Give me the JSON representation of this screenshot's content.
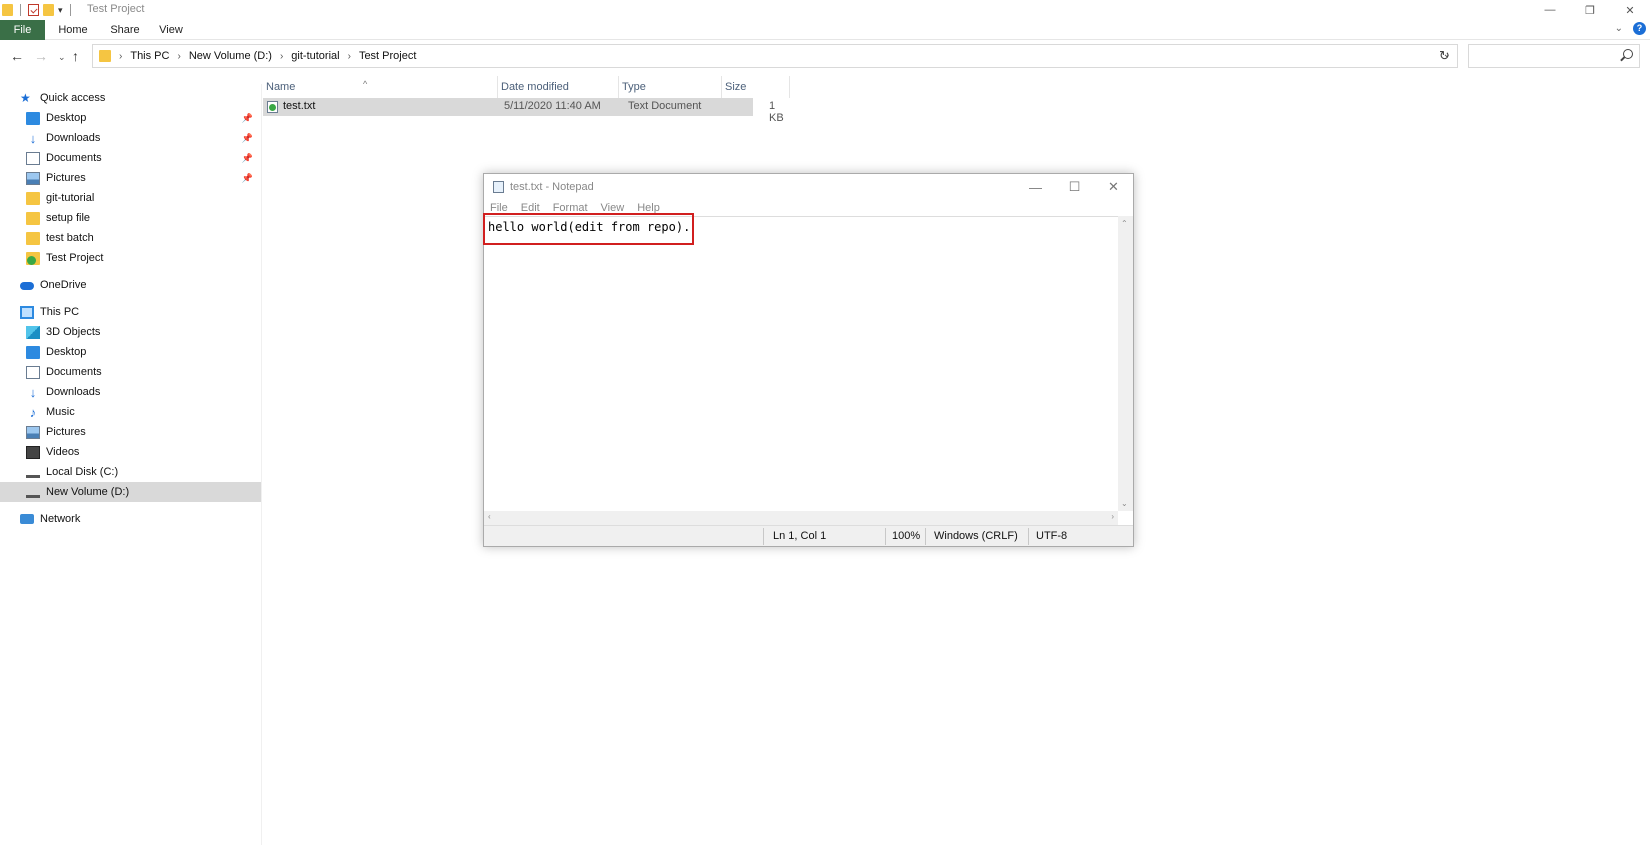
{
  "explorer": {
    "title": "Test Project",
    "ribbon_tabs": {
      "file": "File",
      "home": "Home",
      "share": "Share",
      "view": "View"
    },
    "help": "?",
    "breadcrumb": [
      "This PC",
      "New Volume (D:)",
      "git-tutorial",
      "Test Project"
    ],
    "search_placeholder": ""
  },
  "sidebar": {
    "quick_access": "Quick access",
    "quick_items": [
      {
        "label": "Desktop",
        "icon": "desktop-icon",
        "pinned": true
      },
      {
        "label": "Downloads",
        "icon": "download-icon",
        "pinned": true
      },
      {
        "label": "Documents",
        "icon": "documents-icon",
        "pinned": true
      },
      {
        "label": "Pictures",
        "icon": "pictures-icon",
        "pinned": true
      },
      {
        "label": "git-tutorial",
        "icon": "folder-icon",
        "pinned": false
      },
      {
        "label": "setup file",
        "icon": "folder-icon",
        "pinned": false
      },
      {
        "label": "test batch",
        "icon": "folder-icon",
        "pinned": false
      },
      {
        "label": "Test Project",
        "icon": "git-folder-icon",
        "pinned": false
      }
    ],
    "onedrive": "OneDrive",
    "this_pc": "This PC",
    "pc_items": [
      {
        "label": "3D Objects",
        "icon": "3d-objects-icon"
      },
      {
        "label": "Desktop",
        "icon": "desktop-icon"
      },
      {
        "label": "Documents",
        "icon": "documents-icon"
      },
      {
        "label": "Downloads",
        "icon": "download-icon"
      },
      {
        "label": "Music",
        "icon": "music-icon"
      },
      {
        "label": "Pictures",
        "icon": "pictures-icon"
      },
      {
        "label": "Videos",
        "icon": "videos-icon"
      },
      {
        "label": "Local Disk (C:)",
        "icon": "disk-icon"
      },
      {
        "label": "New Volume (D:)",
        "icon": "disk-icon",
        "selected": true
      }
    ],
    "network": "Network"
  },
  "filelist": {
    "columns": [
      "Name",
      "Date modified",
      "Type",
      "Size"
    ],
    "rows": [
      {
        "name": "test.txt",
        "date": "5/11/2020 11:40 AM",
        "type": "Text Document",
        "size": "1 KB"
      }
    ]
  },
  "notepad": {
    "title": "test.txt - Notepad",
    "menu": [
      "File",
      "Edit",
      "Format",
      "View",
      "Help"
    ],
    "content": "hello world(edit from repo).",
    "status": {
      "position": "Ln 1, Col 1",
      "zoom": "100%",
      "line_ending": "Windows (CRLF)",
      "encoding": "UTF-8"
    }
  },
  "colors": {
    "file_tab": "#3a6f47",
    "highlight": "#d11f1f",
    "selection": "#d9d9d9"
  }
}
